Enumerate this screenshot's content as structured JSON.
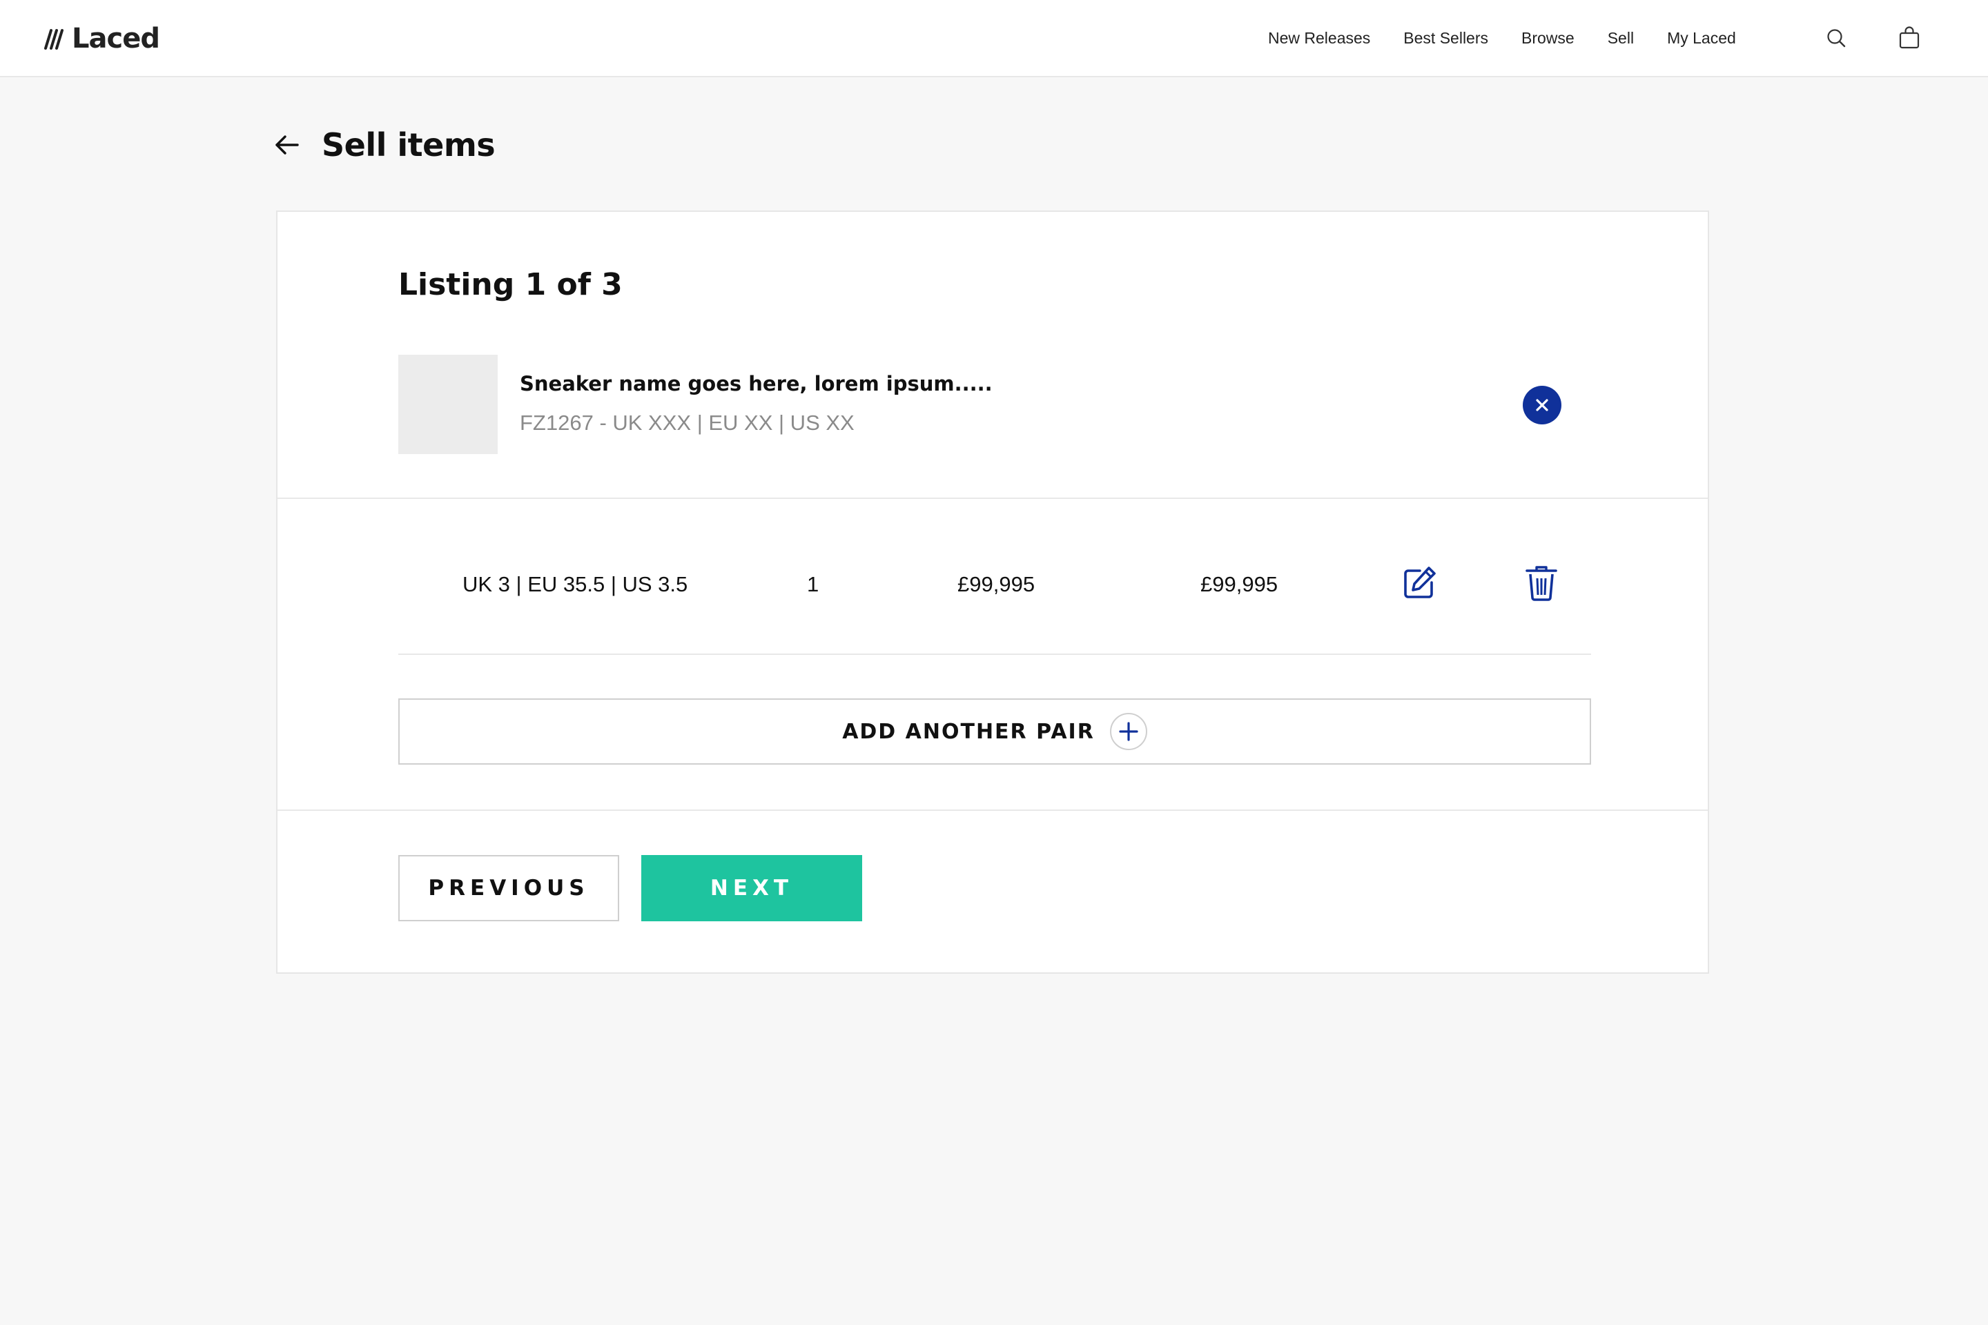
{
  "brand": {
    "name": "Laced",
    "accent_color": "#10319a",
    "cta_color": "#1ec49f"
  },
  "nav": {
    "items": [
      {
        "label": "New Releases"
      },
      {
        "label": "Best Sellers"
      },
      {
        "label": "Browse"
      },
      {
        "label": "Sell"
      },
      {
        "label": "My Laced"
      }
    ],
    "search_icon": "search-icon",
    "bag_icon": "shopping-bag-icon"
  },
  "page": {
    "title": "Sell items",
    "back_icon": "arrow-left-icon"
  },
  "listing": {
    "heading": "Listing 1 of 3",
    "product": {
      "name": "Sneaker name goes here, lorem ipsum.....",
      "meta": "FZ1267 - UK XXX | EU XX | US XX"
    },
    "remove_icon": "close-icon",
    "pairs": [
      {
        "size": "UK 3 | EU 35.5 | US 3.5",
        "quantity": "1",
        "price": "£99,995",
        "total": "£99,995",
        "edit_icon": "edit-icon",
        "delete_icon": "trash-icon"
      }
    ],
    "add_pair_label": "ADD ANOTHER PAIR"
  },
  "actions": {
    "previous_label": "PREVIOUS",
    "next_label": "NEXT"
  }
}
